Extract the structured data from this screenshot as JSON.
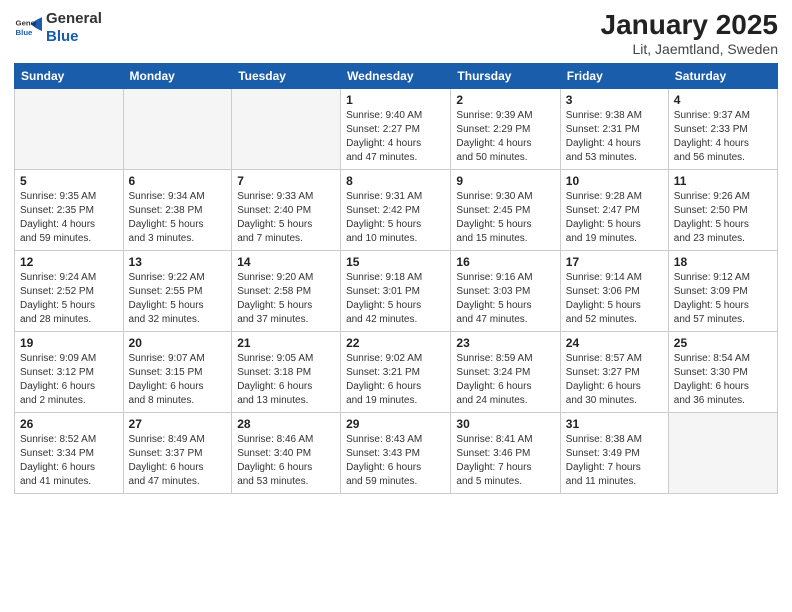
{
  "header": {
    "logo_general": "General",
    "logo_blue": "Blue",
    "title": "January 2025",
    "subtitle": "Lit, Jaemtland, Sweden"
  },
  "weekdays": [
    "Sunday",
    "Monday",
    "Tuesday",
    "Wednesday",
    "Thursday",
    "Friday",
    "Saturday"
  ],
  "weeks": [
    [
      {
        "day": "",
        "content": ""
      },
      {
        "day": "",
        "content": ""
      },
      {
        "day": "",
        "content": ""
      },
      {
        "day": "1",
        "content": "Sunrise: 9:40 AM\nSunset: 2:27 PM\nDaylight: 4 hours\nand 47 minutes."
      },
      {
        "day": "2",
        "content": "Sunrise: 9:39 AM\nSunset: 2:29 PM\nDaylight: 4 hours\nand 50 minutes."
      },
      {
        "day": "3",
        "content": "Sunrise: 9:38 AM\nSunset: 2:31 PM\nDaylight: 4 hours\nand 53 minutes."
      },
      {
        "day": "4",
        "content": "Sunrise: 9:37 AM\nSunset: 2:33 PM\nDaylight: 4 hours\nand 56 minutes."
      }
    ],
    [
      {
        "day": "5",
        "content": "Sunrise: 9:35 AM\nSunset: 2:35 PM\nDaylight: 4 hours\nand 59 minutes."
      },
      {
        "day": "6",
        "content": "Sunrise: 9:34 AM\nSunset: 2:38 PM\nDaylight: 5 hours\nand 3 minutes."
      },
      {
        "day": "7",
        "content": "Sunrise: 9:33 AM\nSunset: 2:40 PM\nDaylight: 5 hours\nand 7 minutes."
      },
      {
        "day": "8",
        "content": "Sunrise: 9:31 AM\nSunset: 2:42 PM\nDaylight: 5 hours\nand 10 minutes."
      },
      {
        "day": "9",
        "content": "Sunrise: 9:30 AM\nSunset: 2:45 PM\nDaylight: 5 hours\nand 15 minutes."
      },
      {
        "day": "10",
        "content": "Sunrise: 9:28 AM\nSunset: 2:47 PM\nDaylight: 5 hours\nand 19 minutes."
      },
      {
        "day": "11",
        "content": "Sunrise: 9:26 AM\nSunset: 2:50 PM\nDaylight: 5 hours\nand 23 minutes."
      }
    ],
    [
      {
        "day": "12",
        "content": "Sunrise: 9:24 AM\nSunset: 2:52 PM\nDaylight: 5 hours\nand 28 minutes."
      },
      {
        "day": "13",
        "content": "Sunrise: 9:22 AM\nSunset: 2:55 PM\nDaylight: 5 hours\nand 32 minutes."
      },
      {
        "day": "14",
        "content": "Sunrise: 9:20 AM\nSunset: 2:58 PM\nDaylight: 5 hours\nand 37 minutes."
      },
      {
        "day": "15",
        "content": "Sunrise: 9:18 AM\nSunset: 3:01 PM\nDaylight: 5 hours\nand 42 minutes."
      },
      {
        "day": "16",
        "content": "Sunrise: 9:16 AM\nSunset: 3:03 PM\nDaylight: 5 hours\nand 47 minutes."
      },
      {
        "day": "17",
        "content": "Sunrise: 9:14 AM\nSunset: 3:06 PM\nDaylight: 5 hours\nand 52 minutes."
      },
      {
        "day": "18",
        "content": "Sunrise: 9:12 AM\nSunset: 3:09 PM\nDaylight: 5 hours\nand 57 minutes."
      }
    ],
    [
      {
        "day": "19",
        "content": "Sunrise: 9:09 AM\nSunset: 3:12 PM\nDaylight: 6 hours\nand 2 minutes."
      },
      {
        "day": "20",
        "content": "Sunrise: 9:07 AM\nSunset: 3:15 PM\nDaylight: 6 hours\nand 8 minutes."
      },
      {
        "day": "21",
        "content": "Sunrise: 9:05 AM\nSunset: 3:18 PM\nDaylight: 6 hours\nand 13 minutes."
      },
      {
        "day": "22",
        "content": "Sunrise: 9:02 AM\nSunset: 3:21 PM\nDaylight: 6 hours\nand 19 minutes."
      },
      {
        "day": "23",
        "content": "Sunrise: 8:59 AM\nSunset: 3:24 PM\nDaylight: 6 hours\nand 24 minutes."
      },
      {
        "day": "24",
        "content": "Sunrise: 8:57 AM\nSunset: 3:27 PM\nDaylight: 6 hours\nand 30 minutes."
      },
      {
        "day": "25",
        "content": "Sunrise: 8:54 AM\nSunset: 3:30 PM\nDaylight: 6 hours\nand 36 minutes."
      }
    ],
    [
      {
        "day": "26",
        "content": "Sunrise: 8:52 AM\nSunset: 3:34 PM\nDaylight: 6 hours\nand 41 minutes."
      },
      {
        "day": "27",
        "content": "Sunrise: 8:49 AM\nSunset: 3:37 PM\nDaylight: 6 hours\nand 47 minutes."
      },
      {
        "day": "28",
        "content": "Sunrise: 8:46 AM\nSunset: 3:40 PM\nDaylight: 6 hours\nand 53 minutes."
      },
      {
        "day": "29",
        "content": "Sunrise: 8:43 AM\nSunset: 3:43 PM\nDaylight: 6 hours\nand 59 minutes."
      },
      {
        "day": "30",
        "content": "Sunrise: 8:41 AM\nSunset: 3:46 PM\nDaylight: 7 hours\nand 5 minutes."
      },
      {
        "day": "31",
        "content": "Sunrise: 8:38 AM\nSunset: 3:49 PM\nDaylight: 7 hours\nand 11 minutes."
      },
      {
        "day": "",
        "content": ""
      }
    ]
  ]
}
